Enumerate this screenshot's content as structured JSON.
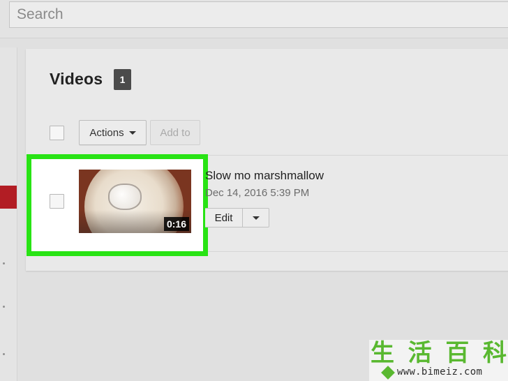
{
  "search": {
    "placeholder": "Search"
  },
  "section": {
    "title": "Videos",
    "count": "1"
  },
  "toolbar": {
    "actions_label": "Actions",
    "add_to_label": "Add to"
  },
  "videos": [
    {
      "title": "Slow mo marshmallow",
      "date": "Dec 14, 2016 5:39 PM",
      "duration": "0:16",
      "edit_label": "Edit"
    }
  ],
  "colors": {
    "highlight": "#28e314",
    "sidebar_active": "#b21d24",
    "badge": "#4b4b4b"
  },
  "watermark": {
    "chars": [
      "生",
      "活",
      "百",
      "科"
    ],
    "url": "www.bimeiz.com"
  }
}
